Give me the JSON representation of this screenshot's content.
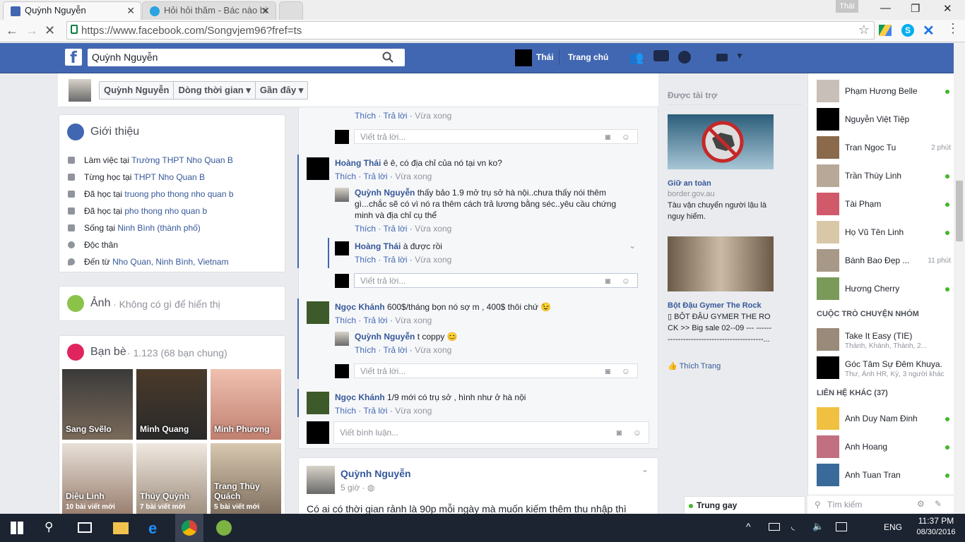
{
  "browser": {
    "tab1_title": "Quỳnh Nguyễn",
    "tab2_title": "Hỏi hỏi thăm - Bác nào bi",
    "user_label": "Thái",
    "url": "https://www.facebook.com/Songvjem96?fref=ts"
  },
  "fb_header": {
    "search_value": "Quỳnh Nguyễn",
    "profile_name": "Thái",
    "home_label": "Trang chủ"
  },
  "subnav": {
    "name": "Quỳnh Nguyễn",
    "timeline": "Dòng thời gian",
    "recent": "Gần đây"
  },
  "intro": {
    "title": "Giới thiệu",
    "rows": [
      {
        "prefix": "Làm việc tại ",
        "link": "Trường THPT Nho Quan B"
      },
      {
        "prefix": "Từng học tại ",
        "link": "THPT Nho Quan B"
      },
      {
        "prefix": "Đã học tại ",
        "link": "truong pho thong nho quan b"
      },
      {
        "prefix": "Đã học tại ",
        "link": "pho thong nho quan b"
      },
      {
        "prefix": "Sống tại ",
        "link": "Ninh Bình (thành phố)"
      },
      {
        "prefix": "Độc thân",
        "link": ""
      },
      {
        "prefix": "Đến từ ",
        "link": "Nho Quan, Ninh Bình, Vietnam"
      }
    ]
  },
  "photos": {
    "title": "Ảnh",
    "empty": "Không có gì để hiển thị"
  },
  "friends": {
    "title": "Bạn bè",
    "count": "1.123 (68 bạn chung)",
    "list": [
      {
        "name": "Sang Svẽlo",
        "sub": ""
      },
      {
        "name": "Minh Quang",
        "sub": ""
      },
      {
        "name": "Minh Phương",
        "sub": ""
      },
      {
        "name": "Diệu Linh",
        "sub": "10 bài viết mới"
      },
      {
        "name": "Thúy Quỳnh",
        "sub": "7 bài viết mới"
      },
      {
        "name": "Trang Thùy Quách",
        "sub": "5 bài viết mới"
      }
    ]
  },
  "comments": {
    "like": "Thích",
    "reply": "Trả lời",
    "time": "Vừa xong",
    "reply_placeholder": "Viết trả lời...",
    "c1_name": "Hoàng Thái",
    "c1_text": "ê ê, có địa chỉ của nó tại vn ko?",
    "c2_name": "Quỳnh Nguyễn",
    "c2_text": "thấy bảo 1.9 mở trụ sở hà nội..chưa thấy nói thêm gì...chắc sẽ có vì nó ra thêm cách trả lương bằng séc..yêu cầu chứng minh và địa chỉ cụ thể",
    "c3_name": "Hoàng Thái",
    "c3_text": "à được rồi",
    "c4_name": "Ngọc Khánh",
    "c4_text": "600$/tháng bọn nó sợ m , 400$ thôi chứ 😉",
    "c5_name": "Quỳnh Nguyễn",
    "c5_text": "t coppy 😊",
    "c6_name": "Ngọc Khánh",
    "c6_text": "1/9 mới có trụ sở , hình như ở hà nội",
    "comment_placeholder": "Viết bình luận..."
  },
  "post2": {
    "author": "Quỳnh Nguyễn",
    "time": "5 giờ",
    "text": "Có ai có thời gian rảnh là 90p mỗi ngày mà muốn kiếm thêm thu nhập thì"
  },
  "ads": {
    "header": "Được tài trợ",
    "ad1_title": "Giữ an toàn",
    "ad1_domain": "border.gov.au",
    "ad1_text": "Tàu vận chuyển người lậu là nguy hiểm.",
    "ad2_title": "Bột Đậu Gymer The Rock",
    "ad2_text": "▯ BỘT ĐẬU GYMER THE ROCK >> Big sale 02--09 --- -------------------------------------------...",
    "like_page": "Thích Trang"
  },
  "chat": {
    "online": [
      {
        "name": "Phạm Hương Belle",
        "status": ""
      },
      {
        "name": "Nguyễn Việt Tiệp",
        "status": ""
      },
      {
        "name": "Tran Ngoc Tu",
        "status": "2 phút"
      },
      {
        "name": "Trần Thùy Linh",
        "status": ""
      },
      {
        "name": "Tài Phạm",
        "status": ""
      },
      {
        "name": "Họ Vũ Tên Linh",
        "status": ""
      },
      {
        "name": "Bánh Bao Đẹp ...",
        "status": "11 phút"
      },
      {
        "name": "Hương Cherry",
        "status": ""
      }
    ],
    "group_header": "CUỘC TRÒ CHUYỆN NHÓM",
    "groups": [
      {
        "name": "Take It Easy (TIE)",
        "sub": "Thành, Khánh, Thành, 2..."
      },
      {
        "name": "Góc Tâm Sự Đêm Khuya.",
        "sub": "Thư, Ánh HR, Kỳ, 3 người khác"
      }
    ],
    "other_header": "LIÊN HỆ KHÁC (37)",
    "others": [
      {
        "name": "Anh Duy Nam Đinh"
      },
      {
        "name": "Anh Hoang"
      },
      {
        "name": "Anh Tuan Tran"
      }
    ],
    "search_placeholder": "Tìm kiếm",
    "bottom_chat": "Trung gay"
  },
  "taskbar": {
    "lang": "ENG",
    "time": "11:37 PM",
    "date": "08/30/2016"
  },
  "colors": {
    "fb_blue": "#4267b2",
    "link": "#365899",
    "online": "#42b72a"
  }
}
